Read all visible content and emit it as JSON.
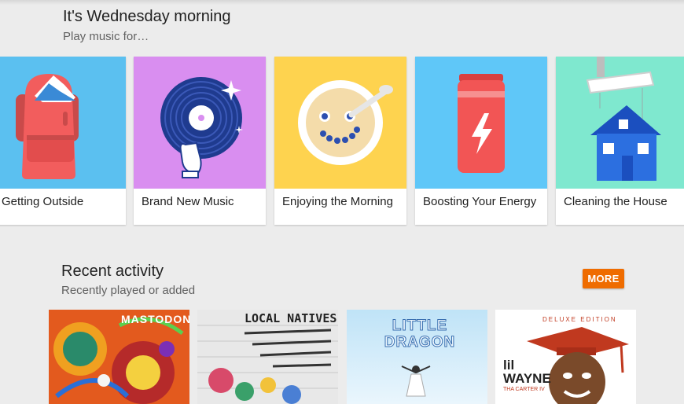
{
  "greeting": {
    "title": "It's Wednesday morning",
    "subtitle": "Play music for…"
  },
  "activities": [
    {
      "label": "Getting Outside",
      "bg": "#5bc0f0",
      "icon": "backpack-icon"
    },
    {
      "label": "Brand New Music",
      "bg": "#d98ef0",
      "icon": "vinyl-record-icon"
    },
    {
      "label": "Enjoying the Morning",
      "bg": "#fed34f",
      "icon": "cereal-bowl-icon"
    },
    {
      "label": "Boosting Your Energy",
      "bg": "#5fc7f8",
      "icon": "battery-icon"
    },
    {
      "label": "Cleaning the House",
      "bg": "#7fe8cf",
      "icon": "house-vacuum-icon"
    }
  ],
  "recent": {
    "title": "Recent activity",
    "subtitle": "Recently played or added",
    "more_label": "MORE",
    "more_color": "#ef6c00",
    "albums": [
      {
        "artist": "MASTODON",
        "name": "album-mastodon"
      },
      {
        "artist": "LOCAL NATIVES",
        "name": "album-local-natives"
      },
      {
        "artist": "LITTLE DRAGON",
        "name": "album-little-dragon"
      },
      {
        "artist": "lil WAYNE",
        "edition": "DELUXE EDITION",
        "subtitle": "THA CARTER IV",
        "name": "album-lil-wayne"
      }
    ]
  }
}
